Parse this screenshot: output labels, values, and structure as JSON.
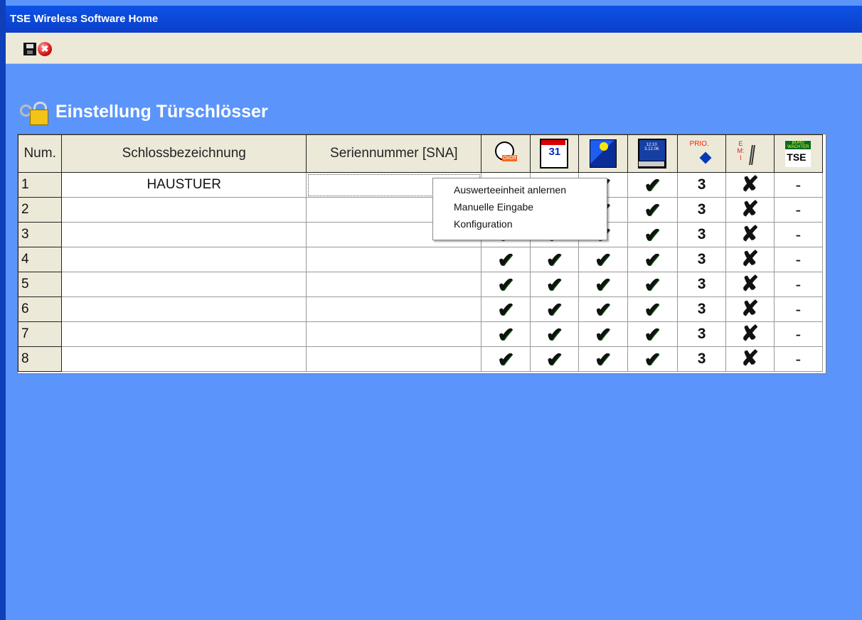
{
  "window": {
    "title": "TSE Wireless Software Home"
  },
  "toolbar": {
    "save_icon": "floppy-disk",
    "close_icon": "red-close-x",
    "close_glyph": "✖"
  },
  "heading": {
    "icon": "lock-keys",
    "text": "Einstellung Türschlösser"
  },
  "table": {
    "columns": [
      "Num.",
      "Schlossbezeichnung",
      "Seriennummer [SNA]"
    ],
    "icon_columns": [
      "clock-on-off-icon",
      "calendar-icon",
      "sun-moon-icon",
      "pc-time-icon",
      "prio-icon",
      "emi-antenna-icon",
      "tse-brand-icon"
    ],
    "rows": [
      {
        "num": "1",
        "name": "HAUSTUER",
        "sna": "",
        "values": [
          "✔",
          "✔",
          "✔",
          "✔",
          "3",
          "✘",
          "-"
        ]
      },
      {
        "num": "2",
        "name": "",
        "sna": "",
        "values": [
          "✔",
          "✔",
          "✔",
          "✔",
          "3",
          "✘",
          "-"
        ]
      },
      {
        "num": "3",
        "name": "",
        "sna": "",
        "values": [
          "✔",
          "✔",
          "✔",
          "✔",
          "3",
          "✘",
          "-"
        ]
      },
      {
        "num": "4",
        "name": "",
        "sna": "",
        "values": [
          "✔",
          "✔",
          "✔",
          "✔",
          "3",
          "✘",
          "-"
        ]
      },
      {
        "num": "5",
        "name": "",
        "sna": "",
        "values": [
          "✔",
          "✔",
          "✔",
          "✔",
          "3",
          "✘",
          "-"
        ]
      },
      {
        "num": "6",
        "name": "",
        "sna": "",
        "values": [
          "✔",
          "✔",
          "✔",
          "✔",
          "3",
          "✘",
          "-"
        ]
      },
      {
        "num": "7",
        "name": "",
        "sna": "",
        "values": [
          "✔",
          "✔",
          "✔",
          "✔",
          "3",
          "✘",
          "-"
        ]
      },
      {
        "num": "8",
        "name": "",
        "sna": "",
        "values": [
          "✔",
          "✔",
          "✔",
          "✔",
          "3",
          "✘",
          "-"
        ]
      }
    ]
  },
  "context_menu": {
    "items": [
      "Auswerteeinheit anlernen",
      "Manuelle Eingabe",
      "Konfiguration"
    ]
  },
  "colors": {
    "background": "#5b95fb",
    "titlebar": "#0d52e7",
    "check": "#139a14",
    "prio": "#1a35ff"
  }
}
